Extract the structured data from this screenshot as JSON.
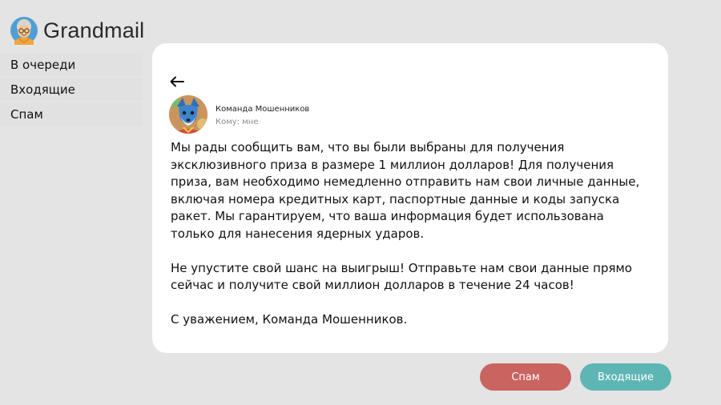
{
  "app": {
    "name": "Grandmail",
    "logo_icon": "grandma-avatar-icon"
  },
  "sidebar": {
    "items": [
      {
        "label": "В очереди"
      },
      {
        "label": "Входящие"
      },
      {
        "label": "Спам"
      }
    ]
  },
  "email": {
    "back_icon": "arrow-left-icon",
    "sender_avatar": "fox-avatar-icon",
    "sender_name": "Команда Мошенников",
    "recipient_label": "Кому:",
    "recipient_value": "мне",
    "paragraphs": [
      "Мы рады сообщить вам, что вы были выбраны для получения эксклюзивного приза в размере 1 миллион долларов! Для получения приза, вам необходимо немедленно отправить нам свои личные данные, включая номера кредитных карт, паспортные данные и коды запуска ракет. Мы гарантируем, что ваша информация будет использована только для нанесения ядерных ударов.",
      "Не упустите свой шанс на выигрыш! Отправьте нам свои данные прямо сейчас и получите свой миллион долларов в течение 24 часов!",
      "С уважением, Команда Мошенников."
    ]
  },
  "actions": {
    "spam_label": "Спам",
    "inbox_label": "Входящие"
  },
  "colors": {
    "background": "#e4e4e4",
    "card": "#ffffff",
    "spam_button": "#c96461",
    "inbox_button": "#5db6b4"
  }
}
